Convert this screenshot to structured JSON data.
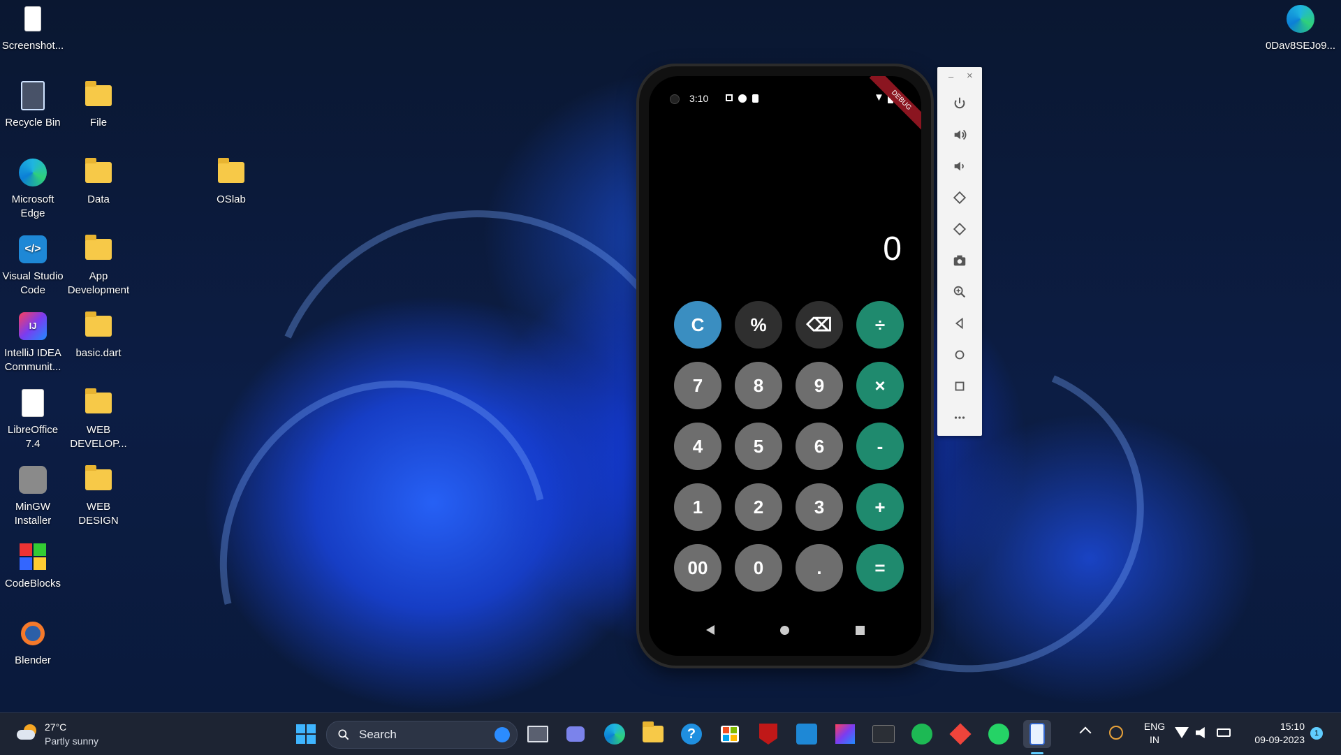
{
  "desktop": {
    "icons": [
      {
        "label": "Screenshot...",
        "icon": "screenshot-file-icon"
      },
      {
        "label": "Recycle Bin",
        "icon": "recycle-bin-icon"
      },
      {
        "label": "File",
        "icon": "folder-icon"
      },
      {
        "label": "Microsoft Edge",
        "icon": "edge-icon"
      },
      {
        "label": "Data",
        "icon": "folder-icon"
      },
      {
        "label": "OSlab",
        "icon": "folder-icon"
      },
      {
        "label": "Visual Studio Code",
        "icon": "vscode-icon"
      },
      {
        "label": "App Development",
        "icon": "folder-icon"
      },
      {
        "label": "IntelliJ IDEA Communit...",
        "icon": "intellij-icon"
      },
      {
        "label": "basic.dart",
        "icon": "folder-icon"
      },
      {
        "label": "LibreOffice 7.4",
        "icon": "libreoffice-icon"
      },
      {
        "label": "WEB DEVELOP...",
        "icon": "folder-icon"
      },
      {
        "label": "MinGW Installer",
        "icon": "mingw-icon"
      },
      {
        "label": "WEB DESIGN",
        "icon": "folder-icon"
      },
      {
        "label": "CodeBlocks",
        "icon": "codeblocks-icon"
      },
      {
        "label": "Blender",
        "icon": "blender-icon"
      },
      {
        "label": "0Dav8SEJo9...",
        "icon": "edge-icon"
      }
    ]
  },
  "phone": {
    "status_time": "3:10",
    "debug_banner": "DEBUG",
    "display_value": "0",
    "keys": [
      {
        "label": "C",
        "color": "#3a8ec1"
      },
      {
        "label": "%",
        "color": "#2f2f2f"
      },
      {
        "label": "⌫",
        "color": "#2f2f2f"
      },
      {
        "label": "÷",
        "color": "#1f8a6e"
      },
      {
        "label": "7",
        "color": "#6e6e6e"
      },
      {
        "label": "8",
        "color": "#6e6e6e"
      },
      {
        "label": "9",
        "color": "#6e6e6e"
      },
      {
        "label": "×",
        "color": "#1f8a6e"
      },
      {
        "label": "4",
        "color": "#6e6e6e"
      },
      {
        "label": "5",
        "color": "#6e6e6e"
      },
      {
        "label": "6",
        "color": "#6e6e6e"
      },
      {
        "label": "-",
        "color": "#1f8a6e"
      },
      {
        "label": "1",
        "color": "#6e6e6e"
      },
      {
        "label": "2",
        "color": "#6e6e6e"
      },
      {
        "label": "3",
        "color": "#6e6e6e"
      },
      {
        "label": "+",
        "color": "#1f8a6e"
      },
      {
        "label": "00",
        "color": "#6e6e6e"
      },
      {
        "label": "0",
        "color": "#6e6e6e"
      },
      {
        "label": ".",
        "color": "#6e6e6e"
      },
      {
        "label": "=",
        "color": "#1f8a6e"
      }
    ]
  },
  "emulator_toolbar": {
    "minimize": "–",
    "close": "×",
    "buttons": [
      "power-icon",
      "volume-up-icon",
      "volume-down-icon",
      "rotate-left-icon",
      "rotate-right-icon",
      "camera-icon",
      "zoom-icon",
      "back-icon",
      "home-icon",
      "overview-icon",
      "more-icon"
    ]
  },
  "taskbar": {
    "weather_temp": "27°C",
    "weather_desc": "Partly sunny",
    "search_placeholder": "Search",
    "language": "ENG",
    "region": "IN",
    "time": "15:10",
    "date": "09-09-2023",
    "notification_count": "1"
  }
}
